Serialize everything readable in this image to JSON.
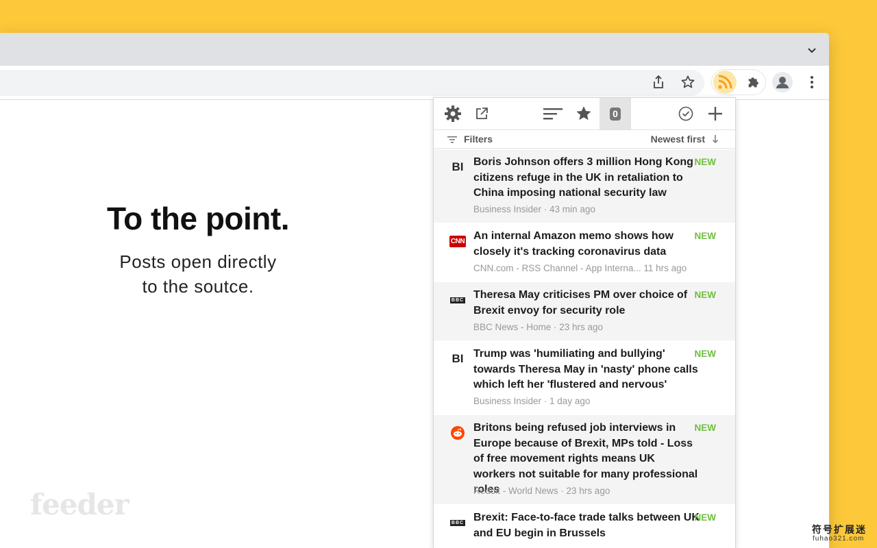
{
  "promo": {
    "title": "To the point.",
    "subtitle_line1": "Posts open directly",
    "subtitle_line2": "to the soutce.",
    "brand": "feeder"
  },
  "browser": {
    "icons": [
      "chevron-down-icon",
      "share-icon",
      "star-icon",
      "rss-icon",
      "puzzle-icon",
      "avatar-icon",
      "more-vert-icon"
    ]
  },
  "popup": {
    "toolbar_icons": [
      "gear-icon",
      "external-link-icon",
      "sort-lines-icon",
      "star-icon",
      "check-circle-icon",
      "plus-icon"
    ],
    "unread_count": "0",
    "filters_label": "Filters",
    "sort_label": "Newest first",
    "items": [
      {
        "source_icon": "BI",
        "title": "Boris Johnson offers 3 million Hong Kong citizens refuge in the UK in retaliation to China imposing national security law",
        "meta": "Business Insider · 43 min ago",
        "badge": "NEW"
      },
      {
        "source_icon": "CNN",
        "title": "An internal Amazon memo shows how closely it's tracking coronavirus data",
        "meta": "CNN.com - RSS Channel - App Interna... 11 hrs ago",
        "badge": "NEW"
      },
      {
        "source_icon": "BBC",
        "title": "Theresa May criticises PM over choice of Brexit envoy for security role",
        "meta": "BBC News - Home · 23 hrs ago",
        "badge": "NEW"
      },
      {
        "source_icon": "BI",
        "title": "Trump was 'humiliating and bullying' towards Theresa May in 'nasty' phone calls which left her 'flustered and nervous'",
        "meta": "Business Insider · 1 day ago",
        "badge": "NEW"
      },
      {
        "source_icon": "reddit-icon",
        "title": "Britons being refused job interviews in Europe because of Brexit, MPs told - Loss of free movement rights means UK workers not suitable for many professional roles",
        "meta": "Reddit - World News · 23 hrs ago",
        "badge": "NEW"
      },
      {
        "source_icon": "BBC",
        "title": "Brexit: Face-to-face trade talks between UK and EU begin in Brussels",
        "meta": "",
        "badge": "NEW"
      }
    ]
  },
  "watermark": {
    "cn": "符号扩展迷",
    "en": "fuhao321.com"
  },
  "colors": {
    "background": "#FDC93A",
    "new_badge": "#6EBE3E",
    "rss_orange": "#F5A01A",
    "cnn_red": "#CC0000",
    "reddit_orange": "#FF4500"
  }
}
